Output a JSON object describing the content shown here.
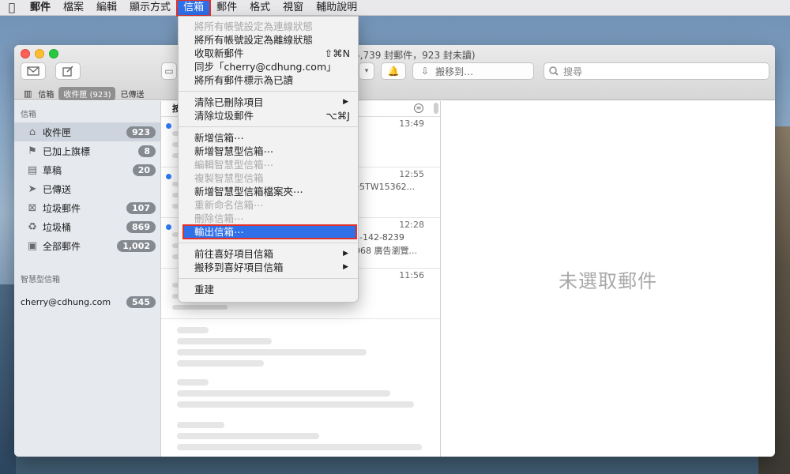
{
  "menubar": {
    "items": [
      "郵件",
      "檔案",
      "編輯",
      "顯示方式",
      "信箱",
      "郵件",
      "格式",
      "視窗",
      "輔助說明"
    ],
    "active_index": 4
  },
  "window": {
    "title_fragment": "5,739 封郵件，923 封未讀)",
    "move_to_label": "搬移到…",
    "search_placeholder": "搜尋"
  },
  "favorites": {
    "items": [
      "信箱",
      "收件匣 (923)",
      "已傳送"
    ],
    "selected_index": 1
  },
  "sidebar": {
    "header": "信箱",
    "items": [
      {
        "label": "收件匣",
        "count": "923",
        "icon": "inbox-icon",
        "selected": true
      },
      {
        "label": "已加上旗標",
        "count": "8",
        "icon": "flag-icon"
      },
      {
        "label": "草稿",
        "count": "20",
        "icon": "draft-icon"
      },
      {
        "label": "已傳送",
        "count": "",
        "icon": "sent-icon"
      },
      {
        "label": "垃圾郵件",
        "count": "107",
        "icon": "junk-icon"
      },
      {
        "label": "垃圾桶",
        "count": "869",
        "icon": "trash-icon"
      },
      {
        "label": "全部郵件",
        "count": "1,002",
        "icon": "archive-icon"
      }
    ],
    "smart_header": "智慧型信箱",
    "account": {
      "label": "cherry@cdhung.com",
      "count": "545"
    }
  },
  "message_list": {
    "header": "按",
    "messages": [
      {
        "time": "13:49",
        "snippet": ""
      },
      {
        "time": "12:55",
        "snippet": "2505TW15362..."
      },
      {
        "time": "12:28",
        "snippet": "853-142-8239"
      },
      {
        "time": "11:56",
        "snippet": ""
      }
    ],
    "snippet_2b": "068 廣告瀏覽..."
  },
  "preview": {
    "empty_text": "未選取郵件"
  },
  "dropdown_menu": {
    "items": [
      {
        "label": "將所有帳號設定為連線狀態",
        "disabled": true
      },
      {
        "label": "將所有帳號設定為離線狀態"
      },
      {
        "label": "收取新郵件",
        "shortcut": "⇧⌘N"
      },
      {
        "label": "同步「cherry@cdhung.com」"
      },
      {
        "label": "將所有郵件標示為已讀"
      },
      {
        "sep": true
      },
      {
        "label": "清除已刪除項目",
        "submenu": true
      },
      {
        "label": "清除垃圾郵件",
        "shortcut": "⌥⌘J"
      },
      {
        "sep": true
      },
      {
        "label": "新增信箱⋯"
      },
      {
        "label": "新增智慧型信箱⋯"
      },
      {
        "label": "編輯智慧型信箱⋯",
        "disabled": true
      },
      {
        "label": "複製智慧型信箱",
        "disabled": true
      },
      {
        "label": "新增智慧型信箱檔案夾⋯"
      },
      {
        "label": "重新命名信箱⋯",
        "disabled": true
      },
      {
        "label": "刪除信箱⋯",
        "disabled": true
      },
      {
        "label": "輸出信箱⋯",
        "highlighted": true
      },
      {
        "sep": true
      },
      {
        "label": "前往喜好項目信箱",
        "submenu": true
      },
      {
        "label": "搬移到喜好項目信箱",
        "submenu": true
      },
      {
        "sep": true
      },
      {
        "label": "重建"
      }
    ]
  }
}
